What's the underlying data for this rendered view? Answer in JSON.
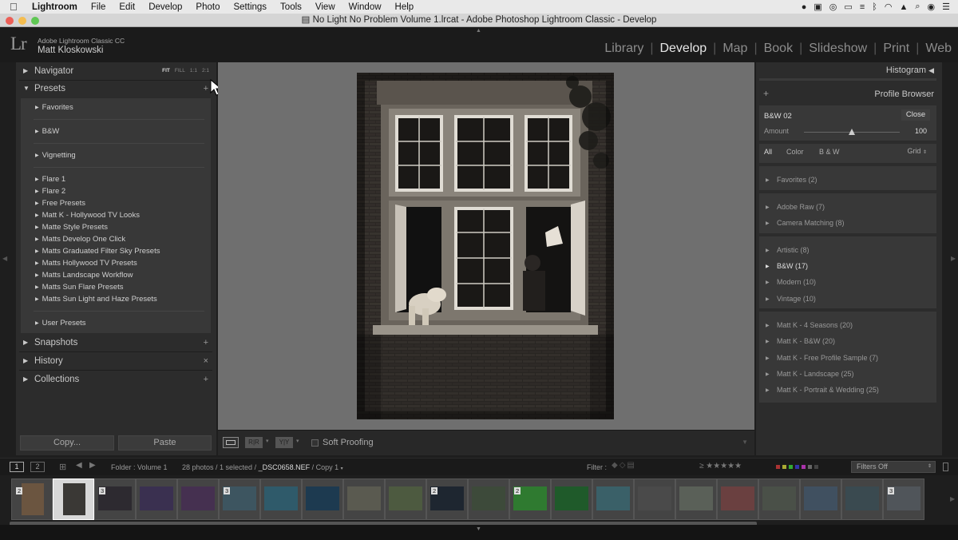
{
  "menubar": {
    "app_name": "Lightroom",
    "items": [
      "File",
      "Edit",
      "Develop",
      "Photo",
      "Settings",
      "Tools",
      "View",
      "Window",
      "Help"
    ]
  },
  "window_title": "No Light No Problem Volume 1.lrcat - Adobe Photoshop Lightroom Classic - Develop",
  "identity_plate": {
    "product": "Adobe Lightroom Classic CC",
    "user": "Matt Kloskowski",
    "logo": "Lr"
  },
  "modules": [
    {
      "label": "Library",
      "active": false
    },
    {
      "label": "Develop",
      "active": true
    },
    {
      "label": "Map",
      "active": false
    },
    {
      "label": "Book",
      "active": false
    },
    {
      "label": "Slideshow",
      "active": false
    },
    {
      "label": "Print",
      "active": false
    },
    {
      "label": "Web",
      "active": false
    }
  ],
  "left_panel": {
    "navigator": {
      "label": "Navigator",
      "zoom_options": [
        "FIT",
        "FILL",
        "1:1",
        "2:1"
      ],
      "zoom_selected": "FIT"
    },
    "presets": {
      "label": "Presets",
      "add": "+",
      "groups": [
        [
          "Favorites"
        ],
        [
          "B&W"
        ],
        [
          "Vignetting"
        ],
        [
          "Flare 1",
          "Flare 2",
          "Free Presets",
          "Matt K - Hollywood TV Looks",
          "Matte Style Presets",
          "Matts Develop One Click",
          "Matts Graduated Filter Sky Presets",
          "Matts Hollywood TV Presets",
          "Matts Landscape Workflow",
          "Matts Sun Flare Presets",
          "Matts Sun Light and Haze Presets"
        ],
        [
          "User Presets"
        ]
      ]
    },
    "snapshots": {
      "label": "Snapshots",
      "action": "+"
    },
    "history": {
      "label": "History",
      "action": "×"
    },
    "collections": {
      "label": "Collections",
      "action": "+"
    },
    "copy_button": "Copy...",
    "paste_button": "Paste"
  },
  "toolbar": {
    "soft_proofing": "Soft Proofing"
  },
  "right_panel": {
    "histogram": {
      "label": "Histogram"
    },
    "profile_browser": {
      "label": "Profile Browser",
      "add": "+",
      "profile_name": "B&W 02",
      "close": "Close",
      "amount_label": "Amount",
      "amount_value": "100",
      "amount_fraction": 0.5,
      "filters": [
        "All",
        "Color",
        "B & W"
      ],
      "filter_selected": "All",
      "view": "Grid",
      "groups": [
        [
          "Favorites (2)"
        ],
        [
          "Adobe Raw (7)",
          "Camera Matching (8)"
        ],
        [
          "Artistic (8)",
          "B&W (17)",
          "Modern (10)",
          "Vintage (10)"
        ],
        [
          "Matt K - 4 Seasons (20)",
          "Matt K - B&W (20)",
          "Matt K - Free Profile Sample (7)",
          "Matt K - Landscape (25)",
          "Matt K - Portrait & Wedding (25)"
        ]
      ],
      "highlighted": "B&W (17)"
    }
  },
  "filmstrip_bar": {
    "view1": "1",
    "view2": "2",
    "folder": "Folder : Volume 1",
    "status": "28 photos / 1 selected / ",
    "filename": "_DSC0658.NEF",
    "copy": " / Copy 1",
    "filter_label": "Filter :",
    "filter_value": "Filters Off"
  },
  "filmstrip": [
    {
      "badge": "2",
      "color": "#6b5540"
    },
    {
      "badge": "",
      "color": "#3a3835",
      "selected": true
    },
    {
      "badge": "3",
      "color": "#2d2a30"
    },
    {
      "badge": "",
      "color": "#3a3050"
    },
    {
      "badge": "",
      "color": "#453050"
    },
    {
      "badge": "3",
      "color": "#3d5560"
    },
    {
      "badge": "",
      "color": "#2f5a6a"
    },
    {
      "badge": "",
      "color": "#1d3a50"
    },
    {
      "badge": "",
      "color": "#5a5a50"
    },
    {
      "badge": "",
      "color": "#4d5a40"
    },
    {
      "badge": "2",
      "color": "#1e2630"
    },
    {
      "badge": "",
      "color": "#3d4a3a"
    },
    {
      "badge": "2",
      "color": "#2f7a30"
    },
    {
      "badge": "",
      "color": "#1f5a2a"
    },
    {
      "badge": "",
      "color": "#3a6068"
    },
    {
      "badge": "",
      "color": "#4a4a4a"
    },
    {
      "badge": "",
      "color": "#5a6058"
    },
    {
      "badge": "",
      "color": "#6a4040"
    },
    {
      "badge": "",
      "color": "#4a5048"
    },
    {
      "badge": "",
      "color": "#405060"
    },
    {
      "badge": "",
      "color": "#3a4a50"
    },
    {
      "badge": "3",
      "color": "#50555a"
    }
  ]
}
